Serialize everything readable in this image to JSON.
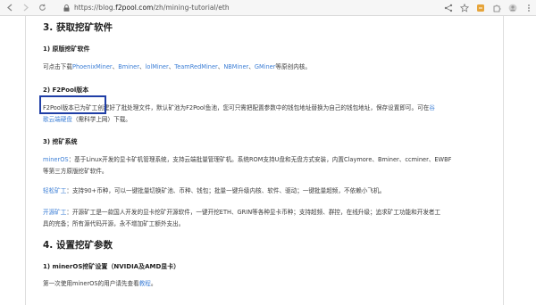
{
  "browser": {
    "url_prefix": "https://blog.",
    "url_domain": "f2pool.com",
    "url_path": "/zh/mining-tutorial/eth"
  },
  "article": {
    "h_get_software": "3. 获取挖矿软件",
    "sub1_title": "1) 原版挖矿软件",
    "sub1_text_before": "可点击下载",
    "sub1_links": [
      "PhoenixMiner",
      "Bminer",
      "lolMiner",
      "TeamRedMiner",
      "NBMiner",
      "GMiner"
    ],
    "sub1_sep": "、",
    "sub1_text_after": "等原创内核。",
    "sub2_title": "2) F2Pool版本",
    "sub2_text": "F2Pool版本已为矿工创建好了批处理文件，默认矿池为F2Pool鱼池，您可只需把配置参数中的钱包地址替换为自己的钱包地址，保存设置即可。可在",
    "sub2_link1": "谷",
    "sub2_link2": "歌云端硬盘",
    "sub2_text_end": "（需科学上网）下载。",
    "sub3_title": "3) 挖矿系统",
    "minerOS_name": "minerOS",
    "minerOS_text1": "：基于Linux开发的显卡矿机管理系统，支持云端批量管理矿机。系统ROM支持U盘和无盘方式安装，内置Claymore、Bminer、ccminer、EWBF",
    "minerOS_text2": "等第三方原版挖矿软件。",
    "qsk_name": "轻松矿工",
    "qsk_text": "：支持90+币种，可以一键批量切换矿池、币种、钱包；批量一键升级内核、软件、驱动；一键批量超频，不依赖小飞机。",
    "open_name": "开源矿工",
    "open_text1": "：开源矿工是一款国人开发的显卡挖矿开源软件，一键开挖ETH、GRIN等各种显卡币种；支持超频、群控，在线升级；追求矿工功能和开发者工",
    "open_text2": "具的完备；所有源代码开源，永不增加矿工额外支出。",
    "h_set_params": "4. 设置挖矿参数",
    "sub4_title": "1) minerOS挖矿设置（NVIDIA及AMD显卡）",
    "sub4_text_before": "第一次使用minerOS的用户请先查看",
    "sub4_link": "教程",
    "sub4_text_after": "。"
  },
  "colors": {
    "link": "#3d7fd6",
    "highlight_box": "#1f3ea6"
  }
}
